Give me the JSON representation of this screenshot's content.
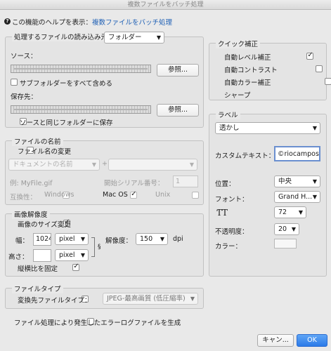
{
  "window": {
    "title": "複数ファイルをバッチ処理"
  },
  "help": {
    "text": "この機能のヘルプを表示：",
    "link": "複数ファイルをバッチ処理"
  },
  "source_group": {
    "read_from_label": "処理するファイルの読み込み元：",
    "read_from_value": "フォルダー",
    "source_label": "ソース：",
    "browse_label": "参照...",
    "include_subfolders": "サブフォルダーをすべて含める",
    "dest_label": "保存先：",
    "browse2_label": "参照...",
    "same_folder": "ソースと同じフォルダーに保存"
  },
  "filename_group": {
    "legend": "ファイルの名前",
    "rename_label": "ファイル名の変更",
    "doc_name_placeholder": "ドキュメントの名前",
    "plus": "+",
    "example": "例: MyFile.gif",
    "serial_label": "開始シリアル番号：",
    "serial_value": "1",
    "compat_label": "互換性：",
    "windows": "Windows",
    "macos": "Mac OS",
    "unix": "Unix"
  },
  "resolution_group": {
    "legend": "画像解像度",
    "resize_label": "画像のサイズ変更",
    "width_label": "幅：",
    "width_value": "1024",
    "width_unit": "pixel",
    "res_label": "解像度：",
    "res_value": "150",
    "res_unit": "dpi",
    "height_label": "高さ：",
    "height_value": "",
    "height_unit": "pixel",
    "constrain_label": "縦横比を固定"
  },
  "filetype_group": {
    "legend": "ファイルタイプ",
    "convert_label": "変換先ファイルタイプ：",
    "convert_value": "JPEG-最高画質 (低圧縮率)"
  },
  "error_log_label": "ファイル処理により発生したエラーログファイルを生成",
  "quick_fix": {
    "legend": "クイック補正",
    "items": [
      {
        "label": "自動レベル補正",
        "checked": true
      },
      {
        "label": "自動コントラスト",
        "checked": false
      },
      {
        "label": "自動カラー補正",
        "checked": false
      },
      {
        "label": "シャープ",
        "checked": true
      }
    ]
  },
  "label_group": {
    "legend": "ラベル",
    "type_value": "透かし",
    "custom_text_label": "カスタムテキスト：",
    "custom_text_value": "©riocampos",
    "position_label": "位置：",
    "position_value": "中央",
    "font_label": "フォント：",
    "font_value": "Grand H...",
    "size_value": "72",
    "opacity_label": "不透明度：",
    "opacity_value": "20",
    "color_label": "カラー："
  },
  "buttons": {
    "cancel": "キャン...",
    "ok": "OK"
  }
}
